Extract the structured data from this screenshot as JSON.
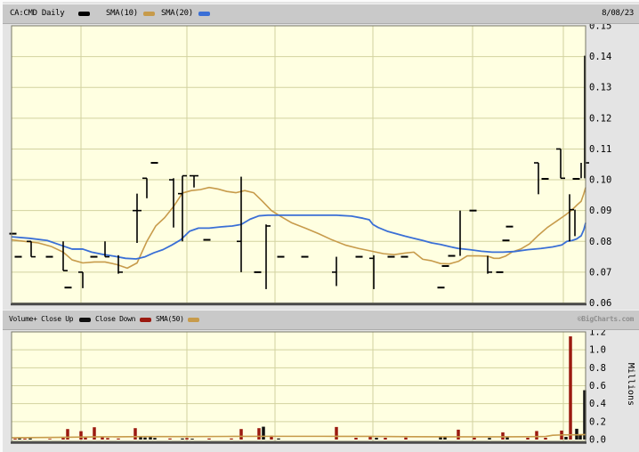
{
  "header": {
    "symbol_label": "CA:CMD Daily",
    "sma10_label": "SMA(10)",
    "sma20_label": "SMA(20)",
    "date": "8/08/23"
  },
  "volume_header": {
    "volume_label": "Volume+ Close Up",
    "close_down_label": "Close Down",
    "sma50_label": "SMA(50)",
    "watermark": "©BigCharts.com"
  },
  "colors": {
    "chart_bg": "#FFFFE1",
    "grid": "#D2D2A0",
    "border": "#787868",
    "frame_dark": "#4A4A4A",
    "sma10": "#C79B4B",
    "sma20": "#3A6FD6",
    "bar": "#000000",
    "vol_up": "#101010",
    "vol_down": "#9B1A10",
    "strip_bg": "#C9C9C9",
    "watermark": "#8F8F8F"
  },
  "chart_data": [
    {
      "id": "price",
      "type": "ohlc-bar",
      "title": "CA:CMD Daily with SMA(10) and SMA(20)",
      "x_unit": "px-trading-days",
      "ylim": [
        0.06,
        0.15
      ],
      "yticks": [
        "0.15",
        "0.14",
        "0.13",
        "0.12",
        "0.11",
        "0.10",
        "0.09",
        "0.08",
        "0.07",
        "0.06"
      ],
      "grid_x": [
        88,
        207,
        306,
        416,
        528,
        630
      ],
      "legend": [
        "CA:CMD Daily",
        "SMA(10)",
        "SMA(20)"
      ],
      "bars": [
        {
          "x": 12,
          "v": 0.0825
        },
        {
          "x": 18,
          "v": 0.075
        },
        {
          "x": 32,
          "h": 0.08,
          "l": 0.075,
          "o": 0.08,
          "c": 0.075
        },
        {
          "x": 53,
          "v": 0.075
        },
        {
          "x": 68,
          "h": 0.08,
          "l": 0.0705,
          "c": 0.0705
        },
        {
          "x": 74,
          "v": 0.065
        },
        {
          "x": 90,
          "h": 0.07,
          "l": 0.0648,
          "o": 0.07
        },
        {
          "x": 103,
          "v": 0.075
        },
        {
          "x": 115,
          "h": 0.08,
          "l": 0.075,
          "c": 0.075
        },
        {
          "x": 130,
          "h": 0.0755,
          "l": 0.0695,
          "c": 0.07
        },
        {
          "x": 151,
          "h": 0.0955,
          "l": 0.0795,
          "o": 0.09,
          "c": 0.09
        },
        {
          "x": 162,
          "h": 0.1005,
          "l": 0.094,
          "o": 0.1005
        },
        {
          "x": 171,
          "v": 0.1055
        },
        {
          "x": 192,
          "h": 0.1005,
          "l": 0.0845,
          "o": 0.1
        },
        {
          "x": 202,
          "h": 0.1013,
          "l": 0.08,
          "o": 0.0955,
          "c": 0.1013
        },
        {
          "x": 215,
          "h": 0.1013,
          "l": 0.0975,
          "o": 0.1013,
          "c": 0.1013
        },
        {
          "x": 230,
          "v": 0.0805
        },
        {
          "x": 268,
          "h": 0.101,
          "l": 0.07,
          "o": 0.08
        },
        {
          "x": 287,
          "v": 0.07
        },
        {
          "x": 296,
          "h": 0.0855,
          "l": 0.0645,
          "c": 0.085
        },
        {
          "x": 313,
          "v": 0.075
        },
        {
          "x": 340,
          "v": 0.075
        },
        {
          "x": 375,
          "h": 0.075,
          "l": 0.0655,
          "o": 0.07
        },
        {
          "x": 401,
          "v": 0.075
        },
        {
          "x": 417,
          "h": 0.0755,
          "l": 0.0645,
          "o": 0.0745
        },
        {
          "x": 437,
          "v": 0.075
        },
        {
          "x": 452,
          "v": 0.075
        },
        {
          "x": 493,
          "v": 0.065
        },
        {
          "x": 498,
          "v": 0.072
        },
        {
          "x": 505,
          "v": 0.0753
        },
        {
          "x": 514,
          "h": 0.09,
          "l": 0.0753
        },
        {
          "x": 529,
          "v": 0.09
        },
        {
          "x": 545,
          "h": 0.0753,
          "l": 0.0695,
          "c": 0.07
        },
        {
          "x": 559,
          "v": 0.07
        },
        {
          "x": 566,
          "v": 0.0803
        },
        {
          "x": 570,
          "v": 0.0848
        },
        {
          "x": 602,
          "h": 0.1055,
          "l": 0.0953,
          "o": 0.1055
        },
        {
          "x": 610,
          "v": 0.1003
        },
        {
          "x": 627,
          "h": 0.11,
          "l": 0.1005,
          "o": 0.11,
          "c": 0.1005
        },
        {
          "x": 637,
          "h": 0.0953,
          "l": 0.08,
          "c": 0.0903
        },
        {
          "x": 643,
          "h": 0.0903,
          "l": 0.0817
        },
        {
          "x": 645,
          "v": 0.1003
        },
        {
          "x": 650,
          "h": 0.1055,
          "l": 0.1005
        },
        {
          "x": 654,
          "h": 0.1403,
          "l": 0.1005,
          "c": 0.1055
        }
      ],
      "sma10": [
        [
          10,
          0.0805
        ],
        [
          25,
          0.08
        ],
        [
          40,
          0.0795
        ],
        [
          55,
          0.0783
        ],
        [
          68,
          0.0765
        ],
        [
          78,
          0.074
        ],
        [
          90,
          0.073
        ],
        [
          103,
          0.0733
        ],
        [
          115,
          0.0733
        ],
        [
          128,
          0.0725
        ],
        [
          140,
          0.0713
        ],
        [
          151,
          0.073
        ],
        [
          162,
          0.08
        ],
        [
          172,
          0.085
        ],
        [
          182,
          0.0877
        ],
        [
          192,
          0.0913
        ],
        [
          202,
          0.0957
        ],
        [
          212,
          0.0965
        ],
        [
          222,
          0.0968
        ],
        [
          232,
          0.0975
        ],
        [
          242,
          0.097
        ],
        [
          252,
          0.0962
        ],
        [
          262,
          0.0958
        ],
        [
          272,
          0.0965
        ],
        [
          282,
          0.0958
        ],
        [
          292,
          0.093
        ],
        [
          302,
          0.09
        ],
        [
          313,
          0.088
        ],
        [
          325,
          0.086
        ],
        [
          340,
          0.0843
        ],
        [
          355,
          0.0825
        ],
        [
          370,
          0.0805
        ],
        [
          385,
          0.0788
        ],
        [
          400,
          0.0777
        ],
        [
          415,
          0.0768
        ],
        [
          428,
          0.076
        ],
        [
          440,
          0.0757
        ],
        [
          452,
          0.0762
        ],
        [
          462,
          0.0765
        ],
        [
          472,
          0.0742
        ],
        [
          482,
          0.0737
        ],
        [
          492,
          0.0728
        ],
        [
          502,
          0.0727
        ],
        [
          512,
          0.0735
        ],
        [
          522,
          0.0753
        ],
        [
          535,
          0.0753
        ],
        [
          545,
          0.0752
        ],
        [
          552,
          0.0745
        ],
        [
          558,
          0.0745
        ],
        [
          565,
          0.0752
        ],
        [
          572,
          0.0765
        ],
        [
          582,
          0.0775
        ],
        [
          592,
          0.0792
        ],
        [
          602,
          0.082
        ],
        [
          612,
          0.0845
        ],
        [
          622,
          0.0865
        ],
        [
          632,
          0.0885
        ],
        [
          640,
          0.0903
        ],
        [
          646,
          0.092
        ],
        [
          650,
          0.093
        ],
        [
          653,
          0.0955
        ],
        [
          655,
          0.0975
        ]
      ],
      "sma20": [
        [
          10,
          0.0815
        ],
        [
          30,
          0.081
        ],
        [
          50,
          0.0803
        ],
        [
          65,
          0.0788
        ],
        [
          78,
          0.0775
        ],
        [
          90,
          0.0775
        ],
        [
          100,
          0.0765
        ],
        [
          112,
          0.0758
        ],
        [
          125,
          0.0752
        ],
        [
          138,
          0.0745
        ],
        [
          150,
          0.0743
        ],
        [
          160,
          0.075
        ],
        [
          170,
          0.0763
        ],
        [
          180,
          0.0773
        ],
        [
          190,
          0.0788
        ],
        [
          200,
          0.0805
        ],
        [
          210,
          0.0833
        ],
        [
          220,
          0.0843
        ],
        [
          232,
          0.0843
        ],
        [
          245,
          0.0847
        ],
        [
          258,
          0.085
        ],
        [
          268,
          0.0855
        ],
        [
          278,
          0.0872
        ],
        [
          288,
          0.0883
        ],
        [
          298,
          0.0885
        ],
        [
          315,
          0.0885
        ],
        [
          335,
          0.0885
        ],
        [
          355,
          0.0885
        ],
        [
          375,
          0.0885
        ],
        [
          392,
          0.0882
        ],
        [
          405,
          0.0875
        ],
        [
          412,
          0.087
        ],
        [
          416,
          0.0855
        ],
        [
          422,
          0.0845
        ],
        [
          432,
          0.0833
        ],
        [
          442,
          0.0825
        ],
        [
          452,
          0.0817
        ],
        [
          462,
          0.081
        ],
        [
          472,
          0.0803
        ],
        [
          482,
          0.0795
        ],
        [
          492,
          0.079
        ],
        [
          502,
          0.0783
        ],
        [
          512,
          0.0777
        ],
        [
          525,
          0.0773
        ],
        [
          538,
          0.0768
        ],
        [
          550,
          0.0765
        ],
        [
          562,
          0.0765
        ],
        [
          575,
          0.0767
        ],
        [
          590,
          0.0773
        ],
        [
          605,
          0.0777
        ],
        [
          618,
          0.0782
        ],
        [
          628,
          0.0788
        ],
        [
          634,
          0.08
        ],
        [
          640,
          0.0803
        ],
        [
          645,
          0.0808
        ],
        [
          650,
          0.0818
        ],
        [
          653,
          0.0838
        ],
        [
          655,
          0.086
        ]
      ]
    },
    {
      "id": "volume",
      "type": "bar",
      "title": "Volume with SMA(50)",
      "ylabel": "Millions",
      "ylim": [
        0,
        1.2
      ],
      "yticks": [
        "1.2",
        "1.0",
        "0.8",
        "0.6",
        "0.4",
        "0.2",
        "0.0"
      ],
      "grid_x": [
        88,
        207,
        306,
        416,
        528,
        630
      ],
      "legend": [
        "Volume+ Close Up",
        "Close Down",
        "SMA(50)"
      ],
      "bars": [
        {
          "x": 14,
          "v": 0.01,
          "dir": "down"
        },
        {
          "x": 19,
          "v": 0.012,
          "dir": "up"
        },
        {
          "x": 25,
          "v": 0.01,
          "dir": "down"
        },
        {
          "x": 31,
          "v": 0.012,
          "dir": "up"
        },
        {
          "x": 53,
          "v": 0.008,
          "dir": "down"
        },
        {
          "x": 68,
          "v": 0.02,
          "dir": "down"
        },
        {
          "x": 73,
          "v": 0.117,
          "dir": "down"
        },
        {
          "x": 88,
          "v": 0.093,
          "dir": "down"
        },
        {
          "x": 93,
          "v": 0.027,
          "dir": "down"
        },
        {
          "x": 103,
          "v": 0.137,
          "dir": "down"
        },
        {
          "x": 112,
          "v": 0.027,
          "dir": "down"
        },
        {
          "x": 118,
          "v": 0.017,
          "dir": "down"
        },
        {
          "x": 130,
          "v": 0.012,
          "dir": "down"
        },
        {
          "x": 149,
          "v": 0.127,
          "dir": "down"
        },
        {
          "x": 155,
          "v": 0.027,
          "dir": "up"
        },
        {
          "x": 160,
          "v": 0.022,
          "dir": "up"
        },
        {
          "x": 166,
          "v": 0.028,
          "dir": "up"
        },
        {
          "x": 171,
          "v": 0.018,
          "dir": "up"
        },
        {
          "x": 188,
          "v": 0.012,
          "dir": "down"
        },
        {
          "x": 202,
          "v": 0.012,
          "dir": "up"
        },
        {
          "x": 207,
          "v": 0.017,
          "dir": "down"
        },
        {
          "x": 213,
          "v": 0.01,
          "dir": "up"
        },
        {
          "x": 232,
          "v": 0.012,
          "dir": "down"
        },
        {
          "x": 257,
          "v": 0.012,
          "dir": "down"
        },
        {
          "x": 268,
          "v": 0.117,
          "dir": "down"
        },
        {
          "x": 288,
          "v": 0.127,
          "dir": "down"
        },
        {
          "x": 293,
          "v": 0.143,
          "dir": "up"
        },
        {
          "x": 302,
          "v": 0.043,
          "dir": "down"
        },
        {
          "x": 310,
          "v": 0.012,
          "dir": "up"
        },
        {
          "x": 375,
          "v": 0.14,
          "dir": "down"
        },
        {
          "x": 397,
          "v": 0.02,
          "dir": "down"
        },
        {
          "x": 413,
          "v": 0.03,
          "dir": "down"
        },
        {
          "x": 420,
          "v": 0.02,
          "dir": "up"
        },
        {
          "x": 430,
          "v": 0.02,
          "dir": "down"
        },
        {
          "x": 453,
          "v": 0.022,
          "dir": "down"
        },
        {
          "x": 492,
          "v": 0.03,
          "dir": "up"
        },
        {
          "x": 497,
          "v": 0.025,
          "dir": "up"
        },
        {
          "x": 512,
          "v": 0.11,
          "dir": "down"
        },
        {
          "x": 530,
          "v": 0.02,
          "dir": "down"
        },
        {
          "x": 547,
          "v": 0.018,
          "dir": "up"
        },
        {
          "x": 562,
          "v": 0.08,
          "dir": "down"
        },
        {
          "x": 567,
          "v": 0.025,
          "dir": "up"
        },
        {
          "x": 590,
          "v": 0.02,
          "dir": "down"
        },
        {
          "x": 600,
          "v": 0.095,
          "dir": "down"
        },
        {
          "x": 610,
          "v": 0.02,
          "dir": "down"
        },
        {
          "x": 628,
          "v": 0.1,
          "dir": "down"
        },
        {
          "x": 633,
          "v": 0.03,
          "dir": "up"
        },
        {
          "x": 638,
          "v": 1.15,
          "dir": "down"
        },
        {
          "x": 645,
          "v": 0.12,
          "dir": "up"
        },
        {
          "x": 649,
          "v": 0.06,
          "dir": "up"
        },
        {
          "x": 654,
          "v": 0.55,
          "dir": "up"
        }
      ],
      "sma50": [
        [
          10,
          0.02
        ],
        [
          60,
          0.024
        ],
        [
          110,
          0.03
        ],
        [
          160,
          0.033
        ],
        [
          210,
          0.033
        ],
        [
          260,
          0.035
        ],
        [
          310,
          0.036
        ],
        [
          360,
          0.036
        ],
        [
          410,
          0.035
        ],
        [
          460,
          0.032
        ],
        [
          510,
          0.03
        ],
        [
          560,
          0.03
        ],
        [
          590,
          0.032
        ],
        [
          610,
          0.034
        ],
        [
          618,
          0.048
        ],
        [
          630,
          0.052
        ],
        [
          645,
          0.053
        ],
        [
          655,
          0.055
        ]
      ]
    }
  ]
}
